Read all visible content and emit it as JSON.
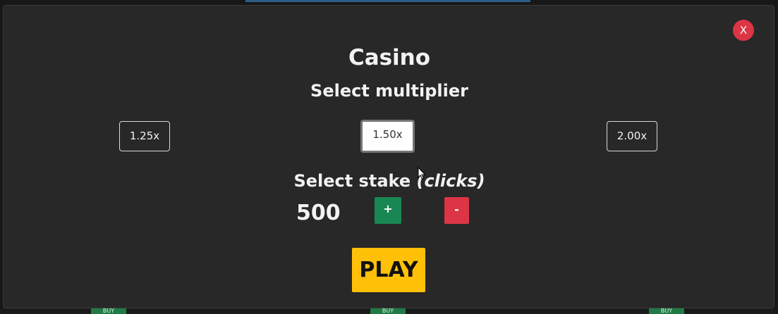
{
  "modal": {
    "title": "Casino",
    "multiplier_label": "Select multiplier",
    "multipliers": [
      {
        "label": "1.25x",
        "selected": false
      },
      {
        "label": "1.50x",
        "selected": true
      },
      {
        "label": "2.00x",
        "selected": false
      }
    ],
    "stake_label": "Select stake",
    "stake_unit": "(clicks)",
    "stake_value": "500",
    "plus_label": "+",
    "minus_label": "-",
    "play_label": "PLAY",
    "close_label": "X"
  },
  "background": {
    "buy_labels": [
      "BUY",
      "BUY",
      "BUY"
    ]
  },
  "colors": {
    "modal_bg": "#282828",
    "page_bg": "#171717",
    "close": "#dc3545",
    "plus": "#198754",
    "minus": "#dc3545",
    "play": "#ffc107"
  },
  "icons": {
    "pointer": "pointer-cursor-icon"
  }
}
